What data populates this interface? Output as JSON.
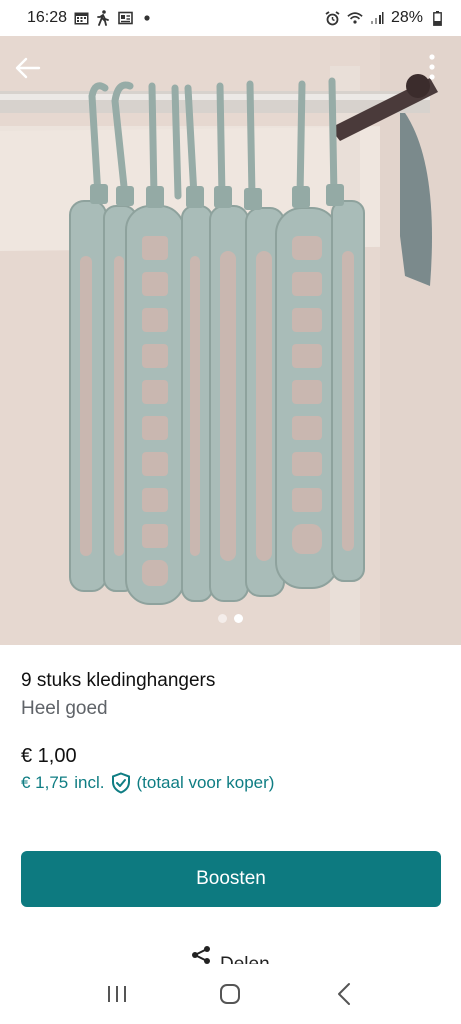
{
  "status_bar": {
    "time": "16:28",
    "battery": "28%",
    "icons_left": [
      "calendar-icon",
      "walking-icon",
      "news-icon",
      "dot-icon"
    ],
    "icons_right": [
      "alarm-icon",
      "wifi-icon",
      "signal-icon",
      "battery-icon"
    ]
  },
  "hero": {
    "image_count": 2,
    "active_index": 1,
    "back_icon": "arrow-left-icon",
    "menu_icon": "more-vertical-icon"
  },
  "listing": {
    "title": "9 stuks kledinghangers",
    "condition": "Heel goed",
    "price": "€ 1,00",
    "buyer_price": "€ 1,75",
    "incl_label": "incl.",
    "buyer_note": "(totaal voor koper)"
  },
  "actions": {
    "boost_label": "Boosten",
    "share_label": "Delen"
  },
  "colors": {
    "accent": "#0d7a80",
    "accent_text": "#0f7d83",
    "hanger": "#9bb0ac"
  },
  "nav_bar": {
    "icons": [
      "recent-apps-icon",
      "home-icon",
      "back-icon"
    ]
  }
}
